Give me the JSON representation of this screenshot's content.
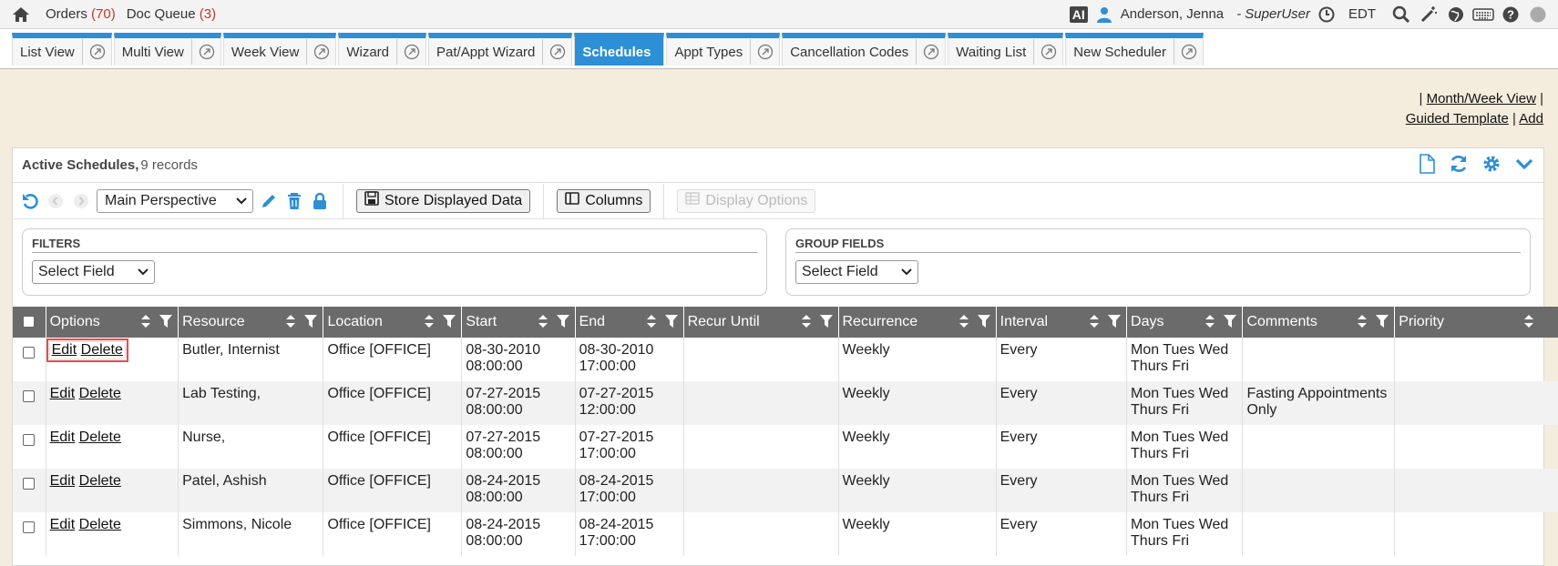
{
  "topbar": {
    "orders_label": "Orders",
    "orders_count": "(70)",
    "docqueue_label": "Doc Queue",
    "docqueue_count": "(3)",
    "ai_badge": "AI",
    "user_name": "Anderson, Jenna",
    "role": "- SuperUser",
    "timezone": "EDT"
  },
  "tabs": [
    {
      "label": "List View",
      "active": false
    },
    {
      "label": "Multi View",
      "active": false
    },
    {
      "label": "Week View",
      "active": false
    },
    {
      "label": "Wizard",
      "active": false
    },
    {
      "label": "Pat/Appt Wizard",
      "active": false
    },
    {
      "label": "Schedules",
      "active": true
    },
    {
      "label": "Appt Types",
      "active": false
    },
    {
      "label": "Cancellation Codes",
      "active": false
    },
    {
      "label": "Waiting List",
      "active": false
    },
    {
      "label": "New Scheduler",
      "active": false
    }
  ],
  "links": {
    "month_week_view": "Month/Week View",
    "guided_template": "Guided Template",
    "add": "Add",
    "sep": "|"
  },
  "panel": {
    "title": "Active Schedules,",
    "subtitle": "9 records"
  },
  "toolbar": {
    "perspective": "Main Perspective",
    "store_label": "Store Displayed Data",
    "columns_label": "Columns",
    "display_options_label": "Display Options"
  },
  "filters": {
    "filters_title": "FILTERS",
    "filters_select": "Select Field",
    "group_title": "GROUP FIELDS",
    "group_select": "Select Field"
  },
  "table": {
    "headers": [
      "Options",
      "Resource",
      "Location",
      "Start",
      "End",
      "Recur Until",
      "Recurrence",
      "Interval",
      "Days",
      "Comments",
      "Priority"
    ],
    "edit_label": "Edit",
    "delete_label": "Delete",
    "rows": [
      {
        "resource": "Butler, Internist",
        "location": "Office [OFFICE]",
        "start_date": "08-30-2010",
        "start_time": "08:00:00",
        "end_date": "08-30-2010",
        "end_time": "17:00:00",
        "recur_until": "",
        "recurrence": "Weekly",
        "interval": "Every",
        "days1": "Mon Tues Wed",
        "days2": "Thurs Fri",
        "comments": "",
        "priority": ""
      },
      {
        "resource": "Lab Testing,",
        "location": "Office [OFFICE]",
        "start_date": "07-27-2015",
        "start_time": "08:00:00",
        "end_date": "07-27-2015",
        "end_time": "12:00:00",
        "recur_until": "",
        "recurrence": "Weekly",
        "interval": "Every",
        "days1": "Mon Tues Wed",
        "days2": "Thurs Fri",
        "comments": "Fasting Appointments Only",
        "priority": ""
      },
      {
        "resource": "Nurse,",
        "location": "Office [OFFICE]",
        "start_date": "07-27-2015",
        "start_time": "08:00:00",
        "end_date": "07-27-2015",
        "end_time": "17:00:00",
        "recur_until": "",
        "recurrence": "Weekly",
        "interval": "Every",
        "days1": "Mon Tues Wed",
        "days2": "Thurs Fri",
        "comments": "",
        "priority": ""
      },
      {
        "resource": "Patel, Ashish",
        "location": "Office [OFFICE]",
        "start_date": "08-24-2015",
        "start_time": "08:00:00",
        "end_date": "08-24-2015",
        "end_time": "17:00:00",
        "recur_until": "",
        "recurrence": "Weekly",
        "interval": "Every",
        "days1": "Mon Tues Wed",
        "days2": "Thurs Fri",
        "comments": "",
        "priority": ""
      },
      {
        "resource": "Simmons, Nicole",
        "location": "Office [OFFICE]",
        "start_date": "08-24-2015",
        "start_time": "08:00:00",
        "end_date": "08-24-2015",
        "end_time": "17:00:00",
        "recur_until": "",
        "recurrence": "Weekly",
        "interval": "Every",
        "days1": "Mon Tues Wed",
        "days2": "Thurs Fri",
        "comments": "",
        "priority": ""
      }
    ]
  },
  "colors": {
    "accent": "#2d8fd5",
    "header_bg": "#6b6b6b",
    "page_bg": "#f4ecdc",
    "count_red": "#c0392b",
    "highlight": "#e05050"
  }
}
